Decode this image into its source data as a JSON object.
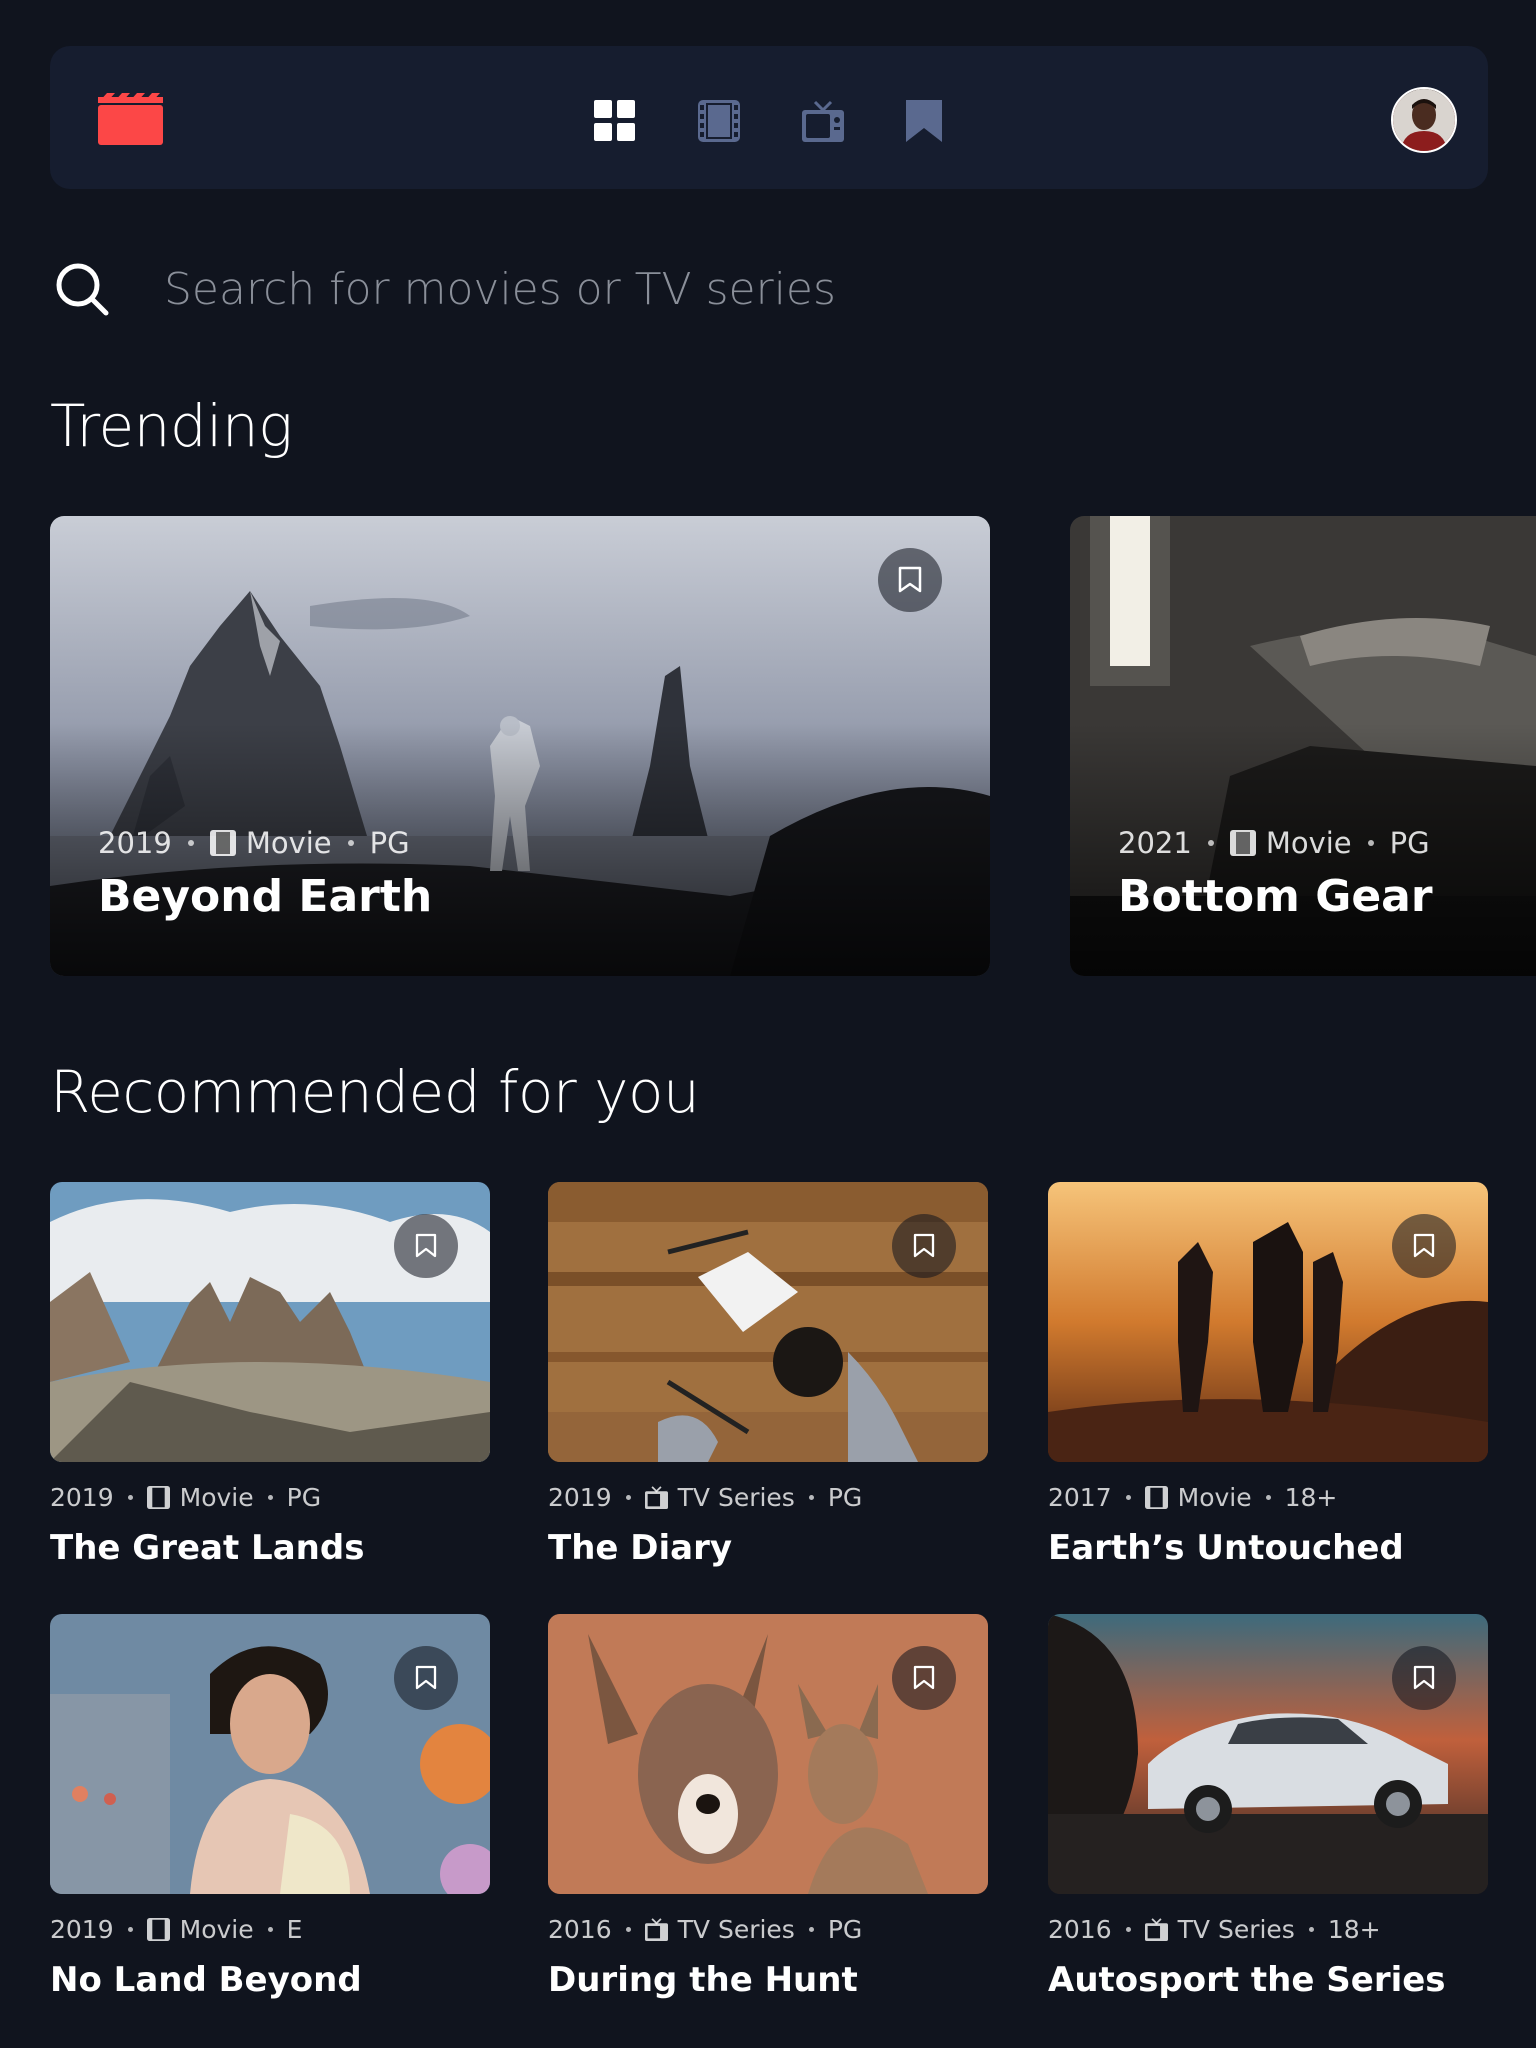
{
  "nav": {
    "items": [
      {
        "name": "home",
        "active": true
      },
      {
        "name": "movies",
        "active": false
      },
      {
        "name": "tv-series",
        "active": false
      },
      {
        "name": "bookmarks",
        "active": false
      }
    ],
    "accent": "#FC4747",
    "inactive": "#5A698F"
  },
  "search": {
    "placeholder": "Search for movies or TV series"
  },
  "sections": {
    "trending": "Trending",
    "recommended": "Recommended for you"
  },
  "trending": [
    {
      "year": "2019",
      "category": "Movie",
      "rating": "PG",
      "title": "Beyond Earth"
    },
    {
      "year": "2021",
      "category": "Movie",
      "rating": "PG",
      "title": "Bottom Gear"
    }
  ],
  "recommended": [
    {
      "year": "2019",
      "category": "Movie",
      "rating": "PG",
      "title": "The Great Lands"
    },
    {
      "year": "2019",
      "category": "TV Series",
      "rating": "PG",
      "title": "The Diary"
    },
    {
      "year": "2017",
      "category": "Movie",
      "rating": "18+",
      "title": "Earth’s Untouched"
    },
    {
      "year": "2019",
      "category": "Movie",
      "rating": "E",
      "title": "No Land Beyond"
    },
    {
      "year": "2016",
      "category": "TV Series",
      "rating": "PG",
      "title": "During the Hunt"
    },
    {
      "year": "2016",
      "category": "TV Series",
      "rating": "18+",
      "title": "Autosport the Series"
    }
  ]
}
